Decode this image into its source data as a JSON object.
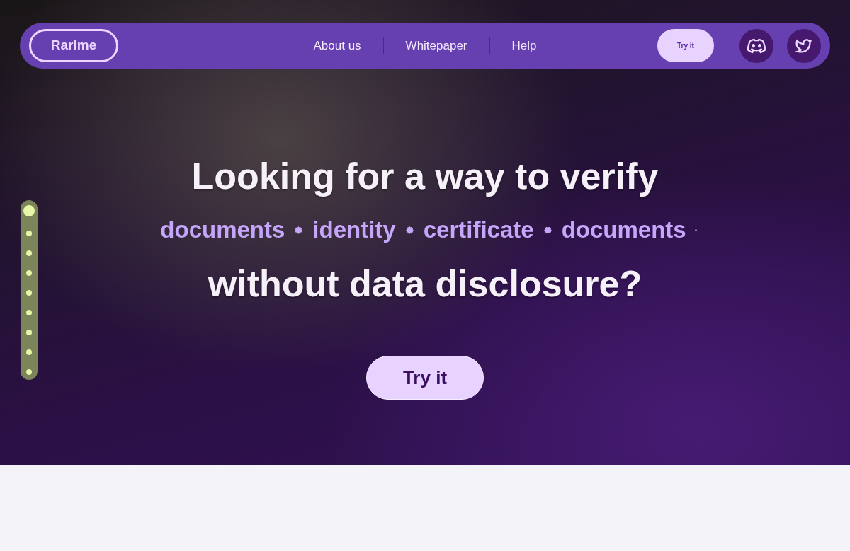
{
  "nav": {
    "logo": "Rarime",
    "links": [
      {
        "label": "About us"
      },
      {
        "label": "Whitepaper"
      },
      {
        "label": "Help"
      }
    ],
    "cta": "Try it",
    "social": [
      {
        "kind": "discord"
      },
      {
        "kind": "twitter"
      }
    ]
  },
  "hero": {
    "title_top": "Looking for a way to verify",
    "rotating_words": [
      "documents",
      "identity",
      "certificate",
      "documents"
    ],
    "title_bottom": "without data disclosure?",
    "cta": "Try it"
  },
  "section_dots": [
    {
      "selected": true
    },
    {
      "selected": false
    },
    {
      "selected": false
    },
    {
      "selected": false
    },
    {
      "selected": false
    },
    {
      "selected": false
    },
    {
      "selected": false
    },
    {
      "selected": false
    },
    {
      "selected": false
    }
  ]
}
